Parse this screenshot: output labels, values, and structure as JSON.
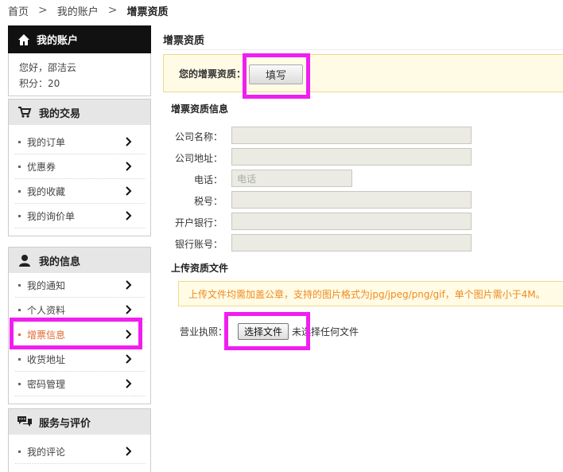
{
  "breadcrumb": {
    "home": "首页",
    "sep1": ">",
    "account": "我的账户",
    "sep2": ">",
    "current": "增票资质"
  },
  "account": {
    "title": "我的账户",
    "greeting": "您好，邵洁云",
    "points": "积分：20"
  },
  "trade": {
    "title": "我的交易",
    "items": [
      {
        "label": "我的订单"
      },
      {
        "label": "优惠券"
      },
      {
        "label": "我的收藏"
      },
      {
        "label": "我的询价单"
      }
    ]
  },
  "info": {
    "title": "我的信息",
    "items": [
      {
        "label": "我的通知"
      },
      {
        "label": "个人资料"
      },
      {
        "label": "增票信息"
      },
      {
        "label": "收货地址"
      },
      {
        "label": "密码管理"
      }
    ]
  },
  "service": {
    "title": "服务与评价",
    "items": [
      {
        "label": "我的评论"
      }
    ]
  },
  "main": {
    "title": "增票资质",
    "qual_label": "您的增票资质：",
    "fill_button": "填写",
    "info_section": "增票资质信息",
    "fields": {
      "company_name": {
        "label": "公司名称：",
        "value": ""
      },
      "company_address": {
        "label": "公司地址：",
        "value": ""
      },
      "phone": {
        "label": "电话：",
        "placeholder": "电话"
      },
      "tax_id": {
        "label": "税号：",
        "value": ""
      },
      "bank": {
        "label": "开户银行：",
        "value": ""
      },
      "account_no": {
        "label": "银行账号：",
        "value": ""
      }
    },
    "upload_section": "上传资质文件",
    "upload_notice": "上传文件均需加盖公章，支持的图片格式为jpg/jpeg/png/gif，单个图片需小于4M。",
    "license_label": "营业执照：",
    "file_button": "选择文件",
    "file_status": "未选择任何文件"
  },
  "colors": {
    "highlight": "#f01ef0",
    "active_item": "#e06a2e",
    "notice_text": "#f08a1e"
  }
}
